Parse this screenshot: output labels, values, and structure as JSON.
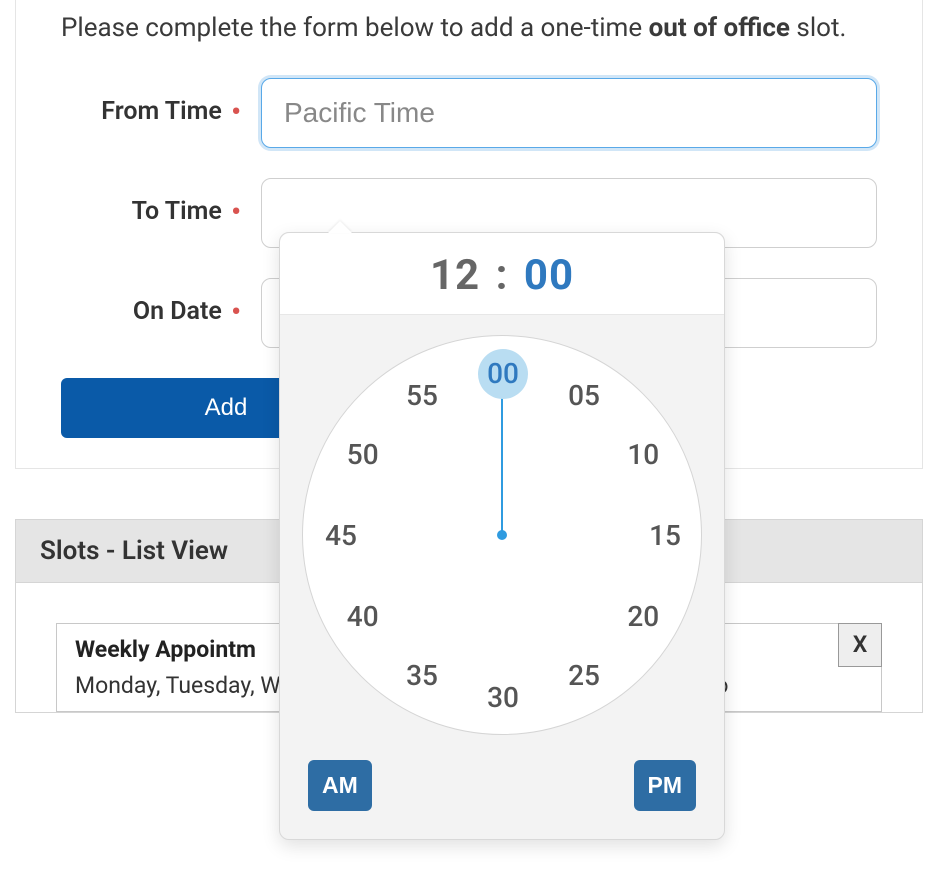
{
  "intro": {
    "prefix": "Please complete the form below to add a one-time ",
    "strong": "out of office",
    "suffix": " slot."
  },
  "form": {
    "from_time": {
      "label": "From Time",
      "placeholder": "Pacific Time",
      "value": ""
    },
    "to_time": {
      "label": "To Time",
      "placeholder": "",
      "value": ""
    },
    "on_date": {
      "label": "On Date",
      "placeholder": "",
      "value": ""
    },
    "submit_label": "Add"
  },
  "time_picker": {
    "hour": "12",
    "minute": "00",
    "separator": " : ",
    "clock_numbers": [
      "00",
      "05",
      "10",
      "15",
      "20",
      "25",
      "30",
      "35",
      "40",
      "45",
      "50",
      "55"
    ],
    "selected": "00",
    "am_label": "AM",
    "pm_label": "PM"
  },
  "slots": {
    "header": "Slots - List View",
    "items": [
      {
        "title": "Weekly Appointm",
        "detail": "Monday, Tuesday, Wednesday, Thursday, Friday - from 9:00am to",
        "delete_label": "X"
      }
    ]
  }
}
